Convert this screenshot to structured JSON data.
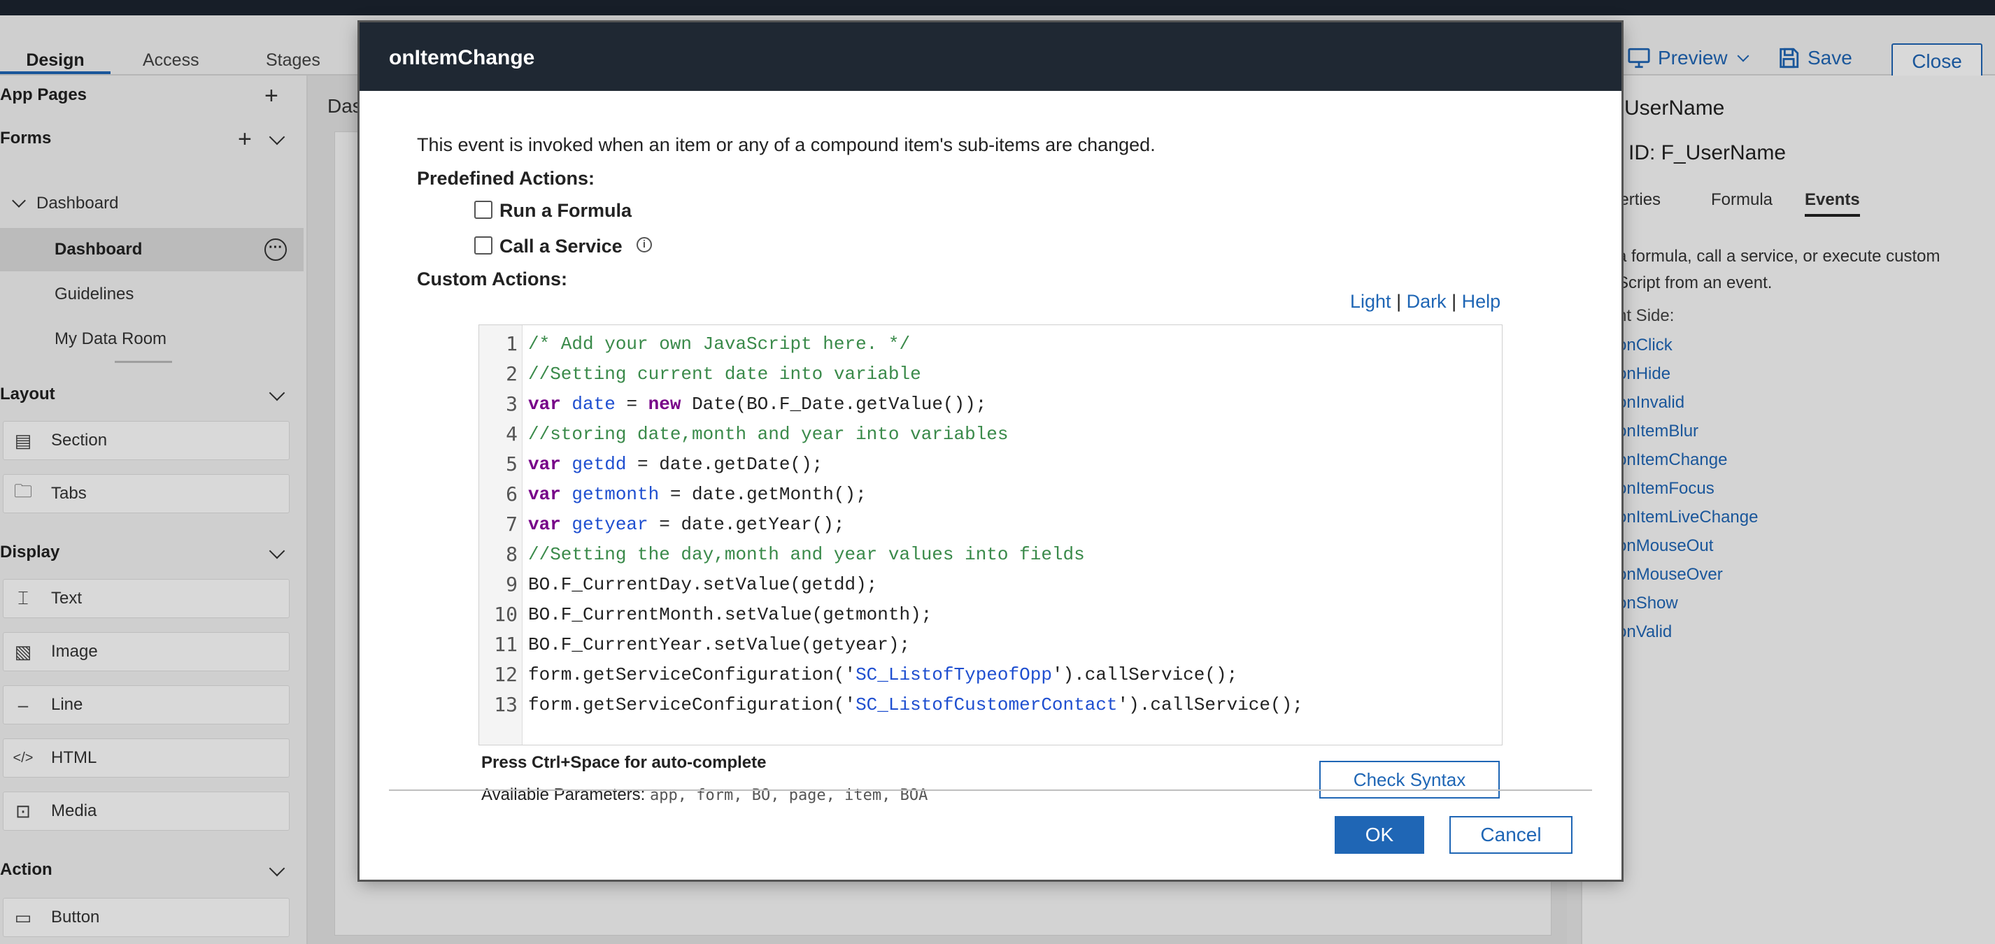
{
  "tabs": [
    {
      "label": "Design",
      "active": true
    },
    {
      "label": "Access",
      "active": false
    },
    {
      "label": "Stages",
      "active": false
    }
  ],
  "header": {
    "preview_label": "Preview",
    "save_label": "Save",
    "close_label": "Close"
  },
  "sidebar": {
    "app_pages": "App Pages",
    "forms": "Forms",
    "tree": [
      {
        "label": "Dashboard",
        "level": 1
      },
      {
        "label": "Dashboard",
        "level": 2,
        "selected": true
      },
      {
        "label": "Guidelines",
        "level": 2
      },
      {
        "label": "My Data Room",
        "level": 2
      }
    ],
    "layout_title": "Layout",
    "layout_items": [
      {
        "label": "Section",
        "icon": "section-icon"
      },
      {
        "label": "Tabs",
        "icon": "folder-icon"
      }
    ],
    "display_title": "Display",
    "display_items": [
      {
        "label": "Text",
        "icon": "text-icon"
      },
      {
        "label": "Image",
        "icon": "image-icon"
      },
      {
        "label": "Line",
        "icon": "line-icon"
      },
      {
        "label": "HTML",
        "icon": "code-icon"
      },
      {
        "label": "Media",
        "icon": "media-icon"
      }
    ],
    "action_title": "Action",
    "action_items": [
      {
        "label": "Button",
        "icon": "button-icon"
      }
    ]
  },
  "canvas": {
    "label": "Das"
  },
  "right_panel": {
    "item_name": "UserName",
    "item_id": "ID: F_UserName",
    "tabs": [
      {
        "label": "perties",
        "active": false
      },
      {
        "label": "Formula",
        "active": false
      },
      {
        "label": "Events",
        "active": true
      }
    ],
    "description": "a formula, call a service, or execute custom Script from an event.",
    "client_side": "nt Side:",
    "events": [
      "onClick",
      "onHide",
      "onInvalid",
      "onItemBlur",
      "onItemChange",
      "onItemFocus",
      "onItemLiveChange",
      "onMouseOut",
      "onMouseOver",
      "onShow",
      "onValid"
    ]
  },
  "modal": {
    "title": "onItemChange",
    "description": "This event is invoked when an item or any of a compound item's sub-items are changed.",
    "predefined_label": "Predefined Actions:",
    "run_formula": "Run a Formula",
    "call_service": "Call a Service",
    "custom_label": "Custom Actions:",
    "theme_links": {
      "light": "Light",
      "sep": "|",
      "dark": "Dark",
      "help": "Help"
    },
    "press_ctrl": "Press Ctrl+Space for auto-complete",
    "available_label": "Available Parameters:",
    "available_params": "app, form, BO, page, item, BOA",
    "check_syntax": "Check Syntax",
    "ok": "OK",
    "cancel": "Cancel",
    "code_lines": [
      "/* Add your own JavaScript here. */",
      "//Setting current date into variable",
      "var date = new Date(BO.F_Date.getValue());",
      "//storing date,month and year into variables",
      "var getdd = date.getDate();",
      "var getmonth = date.getMonth();",
      "var getyear = date.getYear();",
      "//Setting the day,month and year values into fields",
      "BO.F_CurrentDay.setValue(getdd);",
      "BO.F_CurrentMonth.setValue(getmonth);",
      "BO.F_CurrentYear.setValue(getyear);",
      "form.getServiceConfiguration('SC_ListofTypeofOpp').callService();",
      "form.getServiceConfiguration('SC_ListofCustomerContact').callService();"
    ]
  }
}
